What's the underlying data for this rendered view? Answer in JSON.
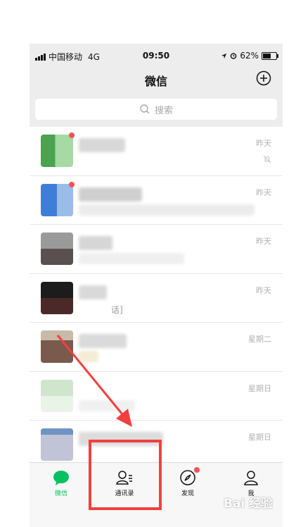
{
  "status_bar": {
    "carrier": "中国移动",
    "network": "4G",
    "time": "09:50",
    "battery": "62%",
    "battery_level": 0.62
  },
  "nav": {
    "title": "微信"
  },
  "search": {
    "placeholder": "搜索"
  },
  "chats": [
    {
      "time": "昨天",
      "has_dot": true,
      "muted": true
    },
    {
      "time": "昨天",
      "has_dot": true,
      "muted": false
    },
    {
      "time": "昨天",
      "has_dot": false,
      "muted": false
    },
    {
      "time": "昨天",
      "has_dot": false,
      "muted": false,
      "message_fragment": "话]"
    },
    {
      "time": "星期二",
      "has_dot": false,
      "muted": false
    },
    {
      "time": "星期日",
      "has_dot": false,
      "muted": false
    },
    {
      "time": "星期日",
      "has_dot": false,
      "muted": false
    }
  ],
  "tab_bar": {
    "tabs": [
      {
        "label": "微信",
        "icon": "chat-bubble-icon",
        "active": true
      },
      {
        "label": "通讯录",
        "icon": "contacts-icon",
        "active": false
      },
      {
        "label": "发现",
        "icon": "compass-icon",
        "active": false,
        "badge": true
      },
      {
        "label": "我",
        "icon": "person-icon",
        "active": false
      }
    ]
  },
  "colors": {
    "accent": "#07c160",
    "annotation": "#f04040",
    "unread_dot": "#f25453"
  },
  "watermark": "Bai 经验"
}
